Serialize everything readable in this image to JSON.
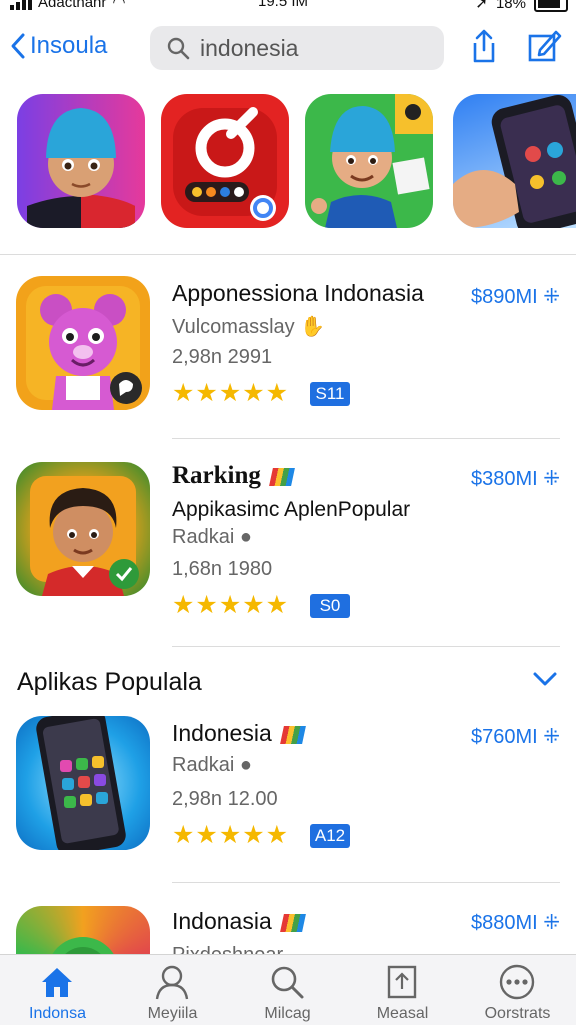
{
  "status_bar": {
    "carrier": "Adactnanr",
    "time": "19.5 IM",
    "battery": "18%"
  },
  "nav": {
    "back_label": "Insoula",
    "search_value": "indonesia"
  },
  "featured": [
    {
      "icon": "boy-beanie-avatar-icon"
    },
    {
      "icon": "red-camera-app-icon"
    },
    {
      "icon": "green-character-app-icon"
    },
    {
      "icon": "phone-in-hand-icon"
    }
  ],
  "apps": [
    {
      "title": "Apponessiona Indonasia",
      "subtitle": "Vulcomasslay",
      "meta": "2,98n 2991",
      "badge": "S11",
      "price": "$890MI",
      "price_icon": "⁜",
      "icon": "pink-bear-app-icon",
      "rating": "★★★★★"
    },
    {
      "title": "Rarking",
      "subtitle": "Appikasimc AplenPopular",
      "developer": "Radkai",
      "meta": "1,68n 1980",
      "badge": "S0",
      "price": "$380MI",
      "price_icon": "⁜",
      "icon": "boy-avatar-app-icon",
      "rating": "★★★★★"
    }
  ],
  "section": {
    "title": "Aplikas Populala"
  },
  "popular": [
    {
      "title": "Indonesia",
      "developer": "Radkai",
      "meta": "2,98n 12.00",
      "badge": "A12",
      "price": "$760MI",
      "price_icon": "⁜",
      "icon": "smartphone-app-icon",
      "rating": "★★★★★"
    },
    {
      "title": "Indonasia",
      "developer": "Pixdeshnear",
      "price": "$880MI",
      "price_icon": "⁜",
      "icon": "colorful-app-icon"
    }
  ],
  "tabs": [
    {
      "label": "Indonsa",
      "icon": "home-icon",
      "active": true
    },
    {
      "label": "Meyiila",
      "icon": "person-icon"
    },
    {
      "label": "Milcag",
      "icon": "search-icon"
    },
    {
      "label": "Measal",
      "icon": "document-icon"
    },
    {
      "label": "Oorstrats",
      "icon": "more-icon"
    }
  ],
  "colors": {
    "accent": "#1a73e8",
    "badge": "#1f6fe0",
    "star": "#f5b800",
    "tabbar": "#f4f4f6"
  }
}
